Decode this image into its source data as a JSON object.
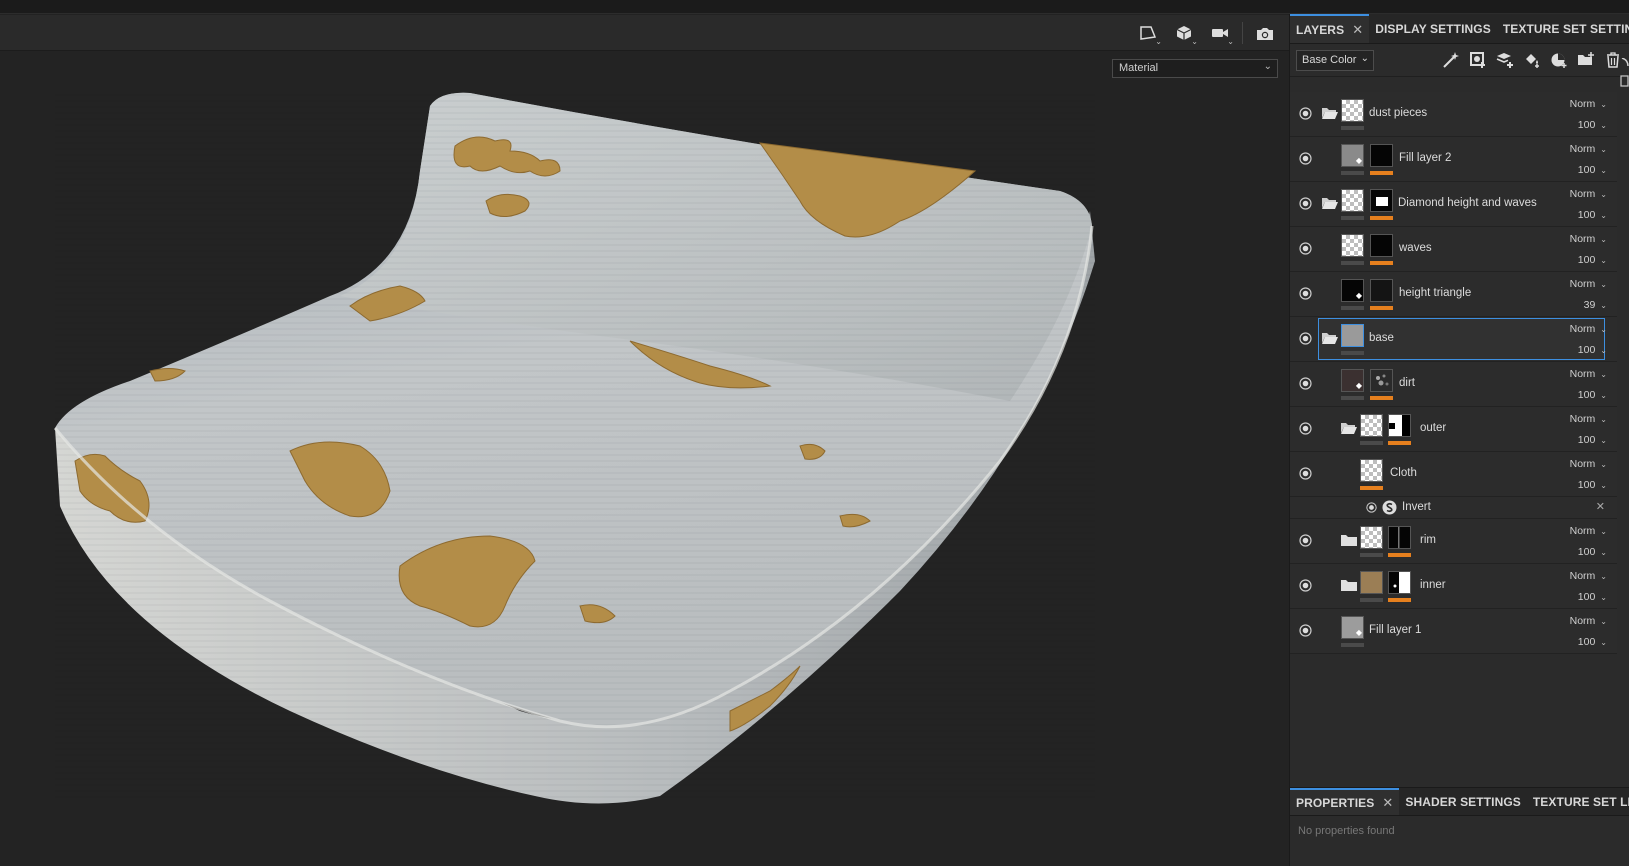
{
  "viewport": {
    "material_mode": "Material",
    "tools": [
      "selection-tool-icon",
      "cube-icon",
      "camera-view-icon",
      "screenshot-icon"
    ]
  },
  "layers_panel": {
    "tabs": [
      {
        "label": "LAYERS",
        "active": true,
        "closable": true
      },
      {
        "label": "DISPLAY SETTINGS",
        "active": false
      },
      {
        "label": "TEXTURE SET SETTINGS",
        "active": false
      }
    ],
    "channel": "Base Color",
    "tool_icons": [
      "add-effect-icon",
      "add-mask-icon",
      "add-layer-icon",
      "add-fill-layer-icon",
      "add-smart-material-icon",
      "add-folder-icon",
      "delete-icon"
    ],
    "layers": [
      {
        "name": "dust pieces",
        "blend": "Norm",
        "opacity": "100"
      },
      {
        "name": "Fill layer 2",
        "blend": "Norm",
        "opacity": "100"
      },
      {
        "name": "Diamond height and waves",
        "blend": "Norm",
        "opacity": "100"
      },
      {
        "name": "waves",
        "blend": "Norm",
        "opacity": "100"
      },
      {
        "name": "height triangle",
        "blend": "Norm",
        "opacity": "39"
      },
      {
        "name": "base",
        "blend": "Norm",
        "opacity": "100"
      },
      {
        "name": "dirt",
        "blend": "Norm",
        "opacity": "100"
      },
      {
        "name": "outer",
        "blend": "Norm",
        "opacity": "100"
      },
      {
        "name": "Cloth",
        "blend": "Norm",
        "opacity": "100"
      },
      {
        "name": "Invert"
      },
      {
        "name": "rim",
        "blend": "Norm",
        "opacity": "100"
      },
      {
        "name": "inner",
        "blend": "Norm",
        "opacity": "100"
      },
      {
        "name": "Fill layer 1",
        "blend": "Norm",
        "opacity": "100"
      }
    ]
  },
  "properties_panel": {
    "tabs": [
      {
        "label": "PROPERTIES",
        "active": true,
        "closable": true
      },
      {
        "label": "SHADER SETTINGS",
        "active": false
      },
      {
        "label": "TEXTURE SET LIST",
        "active": false
      }
    ],
    "empty_message": "No properties found"
  },
  "colors": {
    "accent": "#3d8fe0",
    "mask_bar": "#e6801e",
    "panel_bg": "#2b2b2b",
    "viewport_bg": "#232323"
  }
}
